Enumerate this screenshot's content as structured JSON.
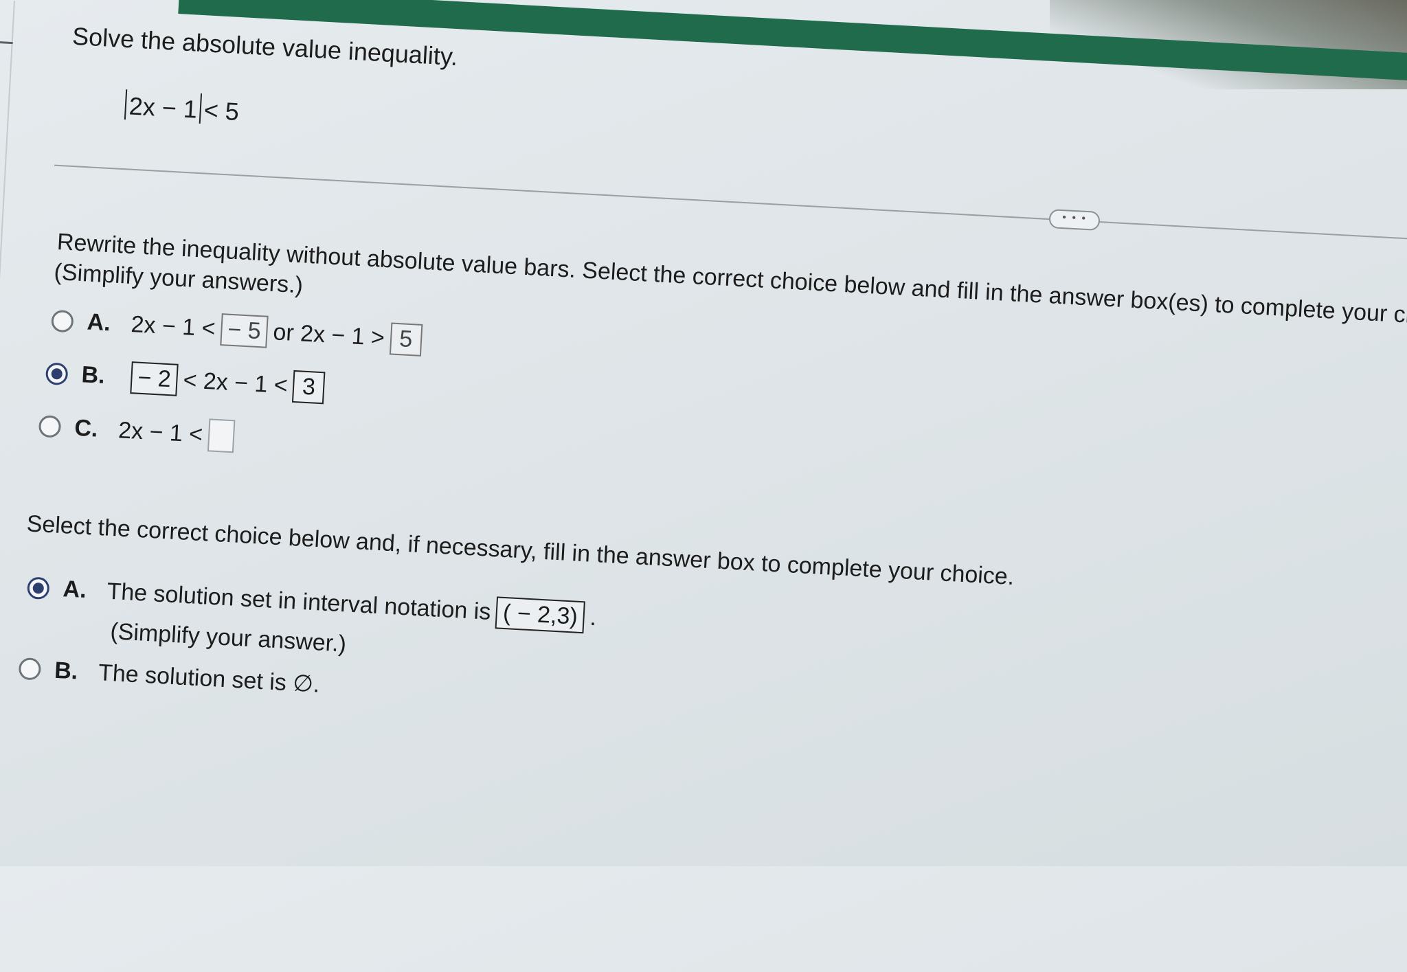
{
  "problem": {
    "title": "Solve the absolute value inequality.",
    "inner": "2x − 1",
    "rest": "< 5"
  },
  "more_button": "• • •",
  "part1": {
    "instruction": "Rewrite the inequality without absolute value bars. Select the correct choice below and fill in the answer box(es) to complete your choice.",
    "subinstruction": "(Simplify your answers.)",
    "choices": [
      {
        "letter": "A.",
        "selected": false,
        "pre": "2x − 1 <",
        "box1": "− 5",
        "mid": "or 2x − 1 >",
        "box2": "5"
      },
      {
        "letter": "B.",
        "selected": true,
        "box1": "− 2",
        "mid": "< 2x − 1 <",
        "box2": "3"
      },
      {
        "letter": "C.",
        "selected": false,
        "pre": "2x − 1 <",
        "box1": ""
      }
    ]
  },
  "part2": {
    "instruction": "Select the correct choice below and, if necessary, fill in the answer box to complete your choice.",
    "choices": [
      {
        "letter": "A.",
        "selected": true,
        "text": "The solution set in interval notation is",
        "box": "( − 2,3)",
        "after": ".",
        "sub": "(Simplify your answer.)"
      },
      {
        "letter": "B.",
        "selected": false,
        "text": "The solution set is ∅."
      }
    ]
  }
}
